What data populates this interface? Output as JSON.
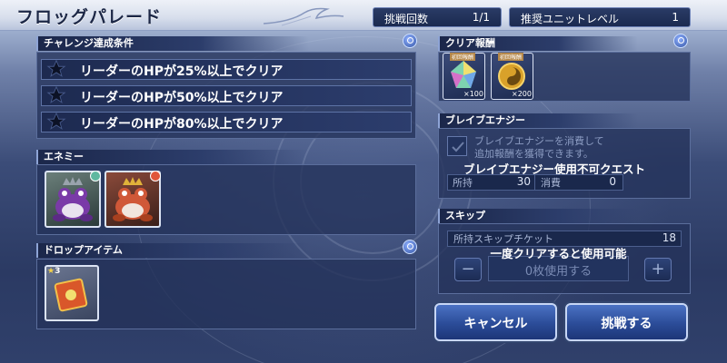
{
  "title": "フロッグパレード",
  "header": {
    "attempts_label": "挑戦回数",
    "attempts_value": "1/1",
    "recommended_label": "推奨ユニットレベル",
    "recommended_value": "1"
  },
  "conditions": {
    "heading": "チャレンジ達成条件",
    "items": [
      "リーダーのHPが25%以上でクリア",
      "リーダーのHPが50%以上でクリア",
      "リーダーのHPが80%以上でクリア"
    ]
  },
  "enemy": {
    "heading": "エネミー"
  },
  "drop": {
    "heading": "ドロップアイテム",
    "stars": "3"
  },
  "rewards": {
    "heading": "クリア報酬",
    "badge": "初回報酬",
    "items": [
      {
        "name": "crystal",
        "count": "×100"
      },
      {
        "name": "gold-coin",
        "count": "×200"
      }
    ]
  },
  "brave": {
    "heading": "ブレイブエナジー",
    "desc_line1": "ブレイブエナジーを消費して",
    "desc_line2": "追加報酬を獲得できます。",
    "warning": "ブレイブエナジー使用不可クエスト",
    "held_label": "所持",
    "held_value": "30",
    "cost_label": "消費",
    "cost_value": "0"
  },
  "skip": {
    "heading": "スキップ",
    "tickets_label": "所持スキップチケット",
    "tickets_value": "18",
    "notice": "一度クリアすると使用可能",
    "usage": "0枚使用する",
    "minus": "−",
    "plus": "+"
  },
  "buttons": {
    "cancel": "キャンセル",
    "challenge": "挑戦する"
  },
  "colors": {
    "accent": "#8ea4d6",
    "panel": "#24325a",
    "button": "#2f4f9a"
  }
}
